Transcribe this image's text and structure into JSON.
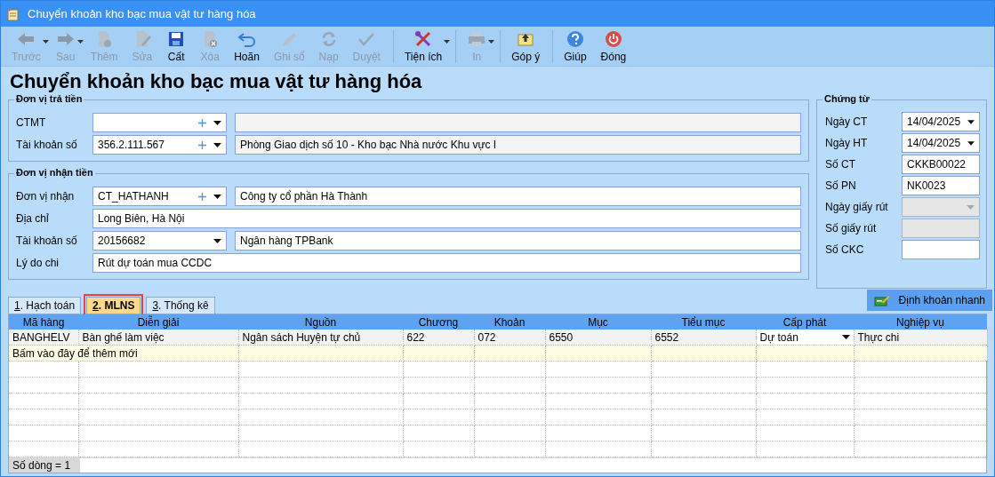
{
  "window": {
    "title": "Chuyển khoản kho bạc mua vật tư hàng hóa"
  },
  "toolbar": [
    {
      "kind": "back",
      "label": "Trước",
      "disabled": true,
      "menu": true,
      "separator_before": false
    },
    {
      "kind": "forward",
      "label": "Sau",
      "disabled": true,
      "menu": true,
      "separator_before": false
    },
    {
      "kind": "new",
      "label": "Thêm",
      "disabled": true,
      "menu": false,
      "separator_before": false
    },
    {
      "kind": "edit",
      "label": "Sửa",
      "disabled": true,
      "menu": false,
      "separator_before": false
    },
    {
      "kind": "save",
      "label": "Cất",
      "disabled": false,
      "menu": false,
      "separator_before": false
    },
    {
      "kind": "delete",
      "label": "Xóa",
      "disabled": true,
      "menu": false,
      "separator_before": false
    },
    {
      "kind": "undo",
      "label": "Hoãn",
      "disabled": false,
      "menu": false,
      "separator_before": false
    },
    {
      "kind": "post",
      "label": "Ghi sổ",
      "disabled": true,
      "menu": false,
      "separator_before": false
    },
    {
      "kind": "reload",
      "label": "Nạp",
      "disabled": true,
      "menu": false,
      "separator_before": false
    },
    {
      "kind": "approve",
      "label": "Duyệt",
      "disabled": true,
      "menu": false,
      "separator_before": false
    },
    {
      "kind": "tools",
      "label": "Tiện ích",
      "disabled": false,
      "menu": true,
      "separator_before": true
    },
    {
      "kind": "print",
      "label": "In",
      "disabled": true,
      "menu": true,
      "separator_before": true
    },
    {
      "kind": "feedback",
      "label": "Góp ý",
      "disabled": false,
      "menu": false,
      "separator_before": true
    },
    {
      "kind": "help",
      "label": "Giúp",
      "disabled": false,
      "menu": false,
      "separator_before": true
    },
    {
      "kind": "close",
      "label": "Đóng",
      "disabled": false,
      "menu": false,
      "separator_before": false
    }
  ],
  "heading": "Chuyển khoản kho bạc mua vật tư hàng hóa",
  "payer": {
    "title": "Đơn vị trả tiền",
    "rows": [
      {
        "label": "CTMT",
        "kind": "lookup",
        "description_disabled": true
      },
      {
        "label": "Tài khoản số",
        "kind": "lookup",
        "value": "356.2.111.567",
        "description": "Phòng Giao dịch số 10 - Kho bạc Nhà nước Khu vực I",
        "description_disabled": true
      }
    ]
  },
  "payee": {
    "title": "Đơn vị nhận tiền",
    "rows": [
      {
        "label": "Đơn vị nhận",
        "kind": "lookup",
        "value": "CT_HATHANH",
        "description": "Công ty cổ phần Hà Thành",
        "description_disabled": false
      },
      {
        "label": "Địa chỉ",
        "kind": "text",
        "value": "Long Biên, Hà Nội"
      },
      {
        "label": "Tài khoản số",
        "kind": "combo",
        "value": "20156682",
        "description": "Ngân hàng TPBank",
        "description_disabled": false
      },
      {
        "label": "Lý do chi",
        "kind": "text",
        "value": "Rút dự toán mua CCDC"
      }
    ]
  },
  "voucher": {
    "title": "Chứng từ",
    "rows": [
      {
        "label": "Ngày CT",
        "kind": "combo",
        "value": "14/04/2025",
        "disabled": false
      },
      {
        "label": "Ngày HT",
        "kind": "combo",
        "value": "14/04/2025",
        "disabled": false
      },
      {
        "label": "Số CT",
        "kind": "text",
        "value": "CKKB00022",
        "disabled": false
      },
      {
        "label": "Số PN",
        "kind": "text",
        "value": "NK0023",
        "disabled": false
      },
      {
        "label": "Ngày giấy rút",
        "kind": "combo",
        "disabled": true
      },
      {
        "label": "Số giấy rút",
        "kind": "text",
        "disabled": true
      },
      {
        "label": "Số CKC",
        "kind": "text",
        "disabled": false
      }
    ]
  },
  "tabs": [
    {
      "label": "1. Hạch toán",
      "selected": false
    },
    {
      "label": "2. MLNS",
      "selected": true
    },
    {
      "label": "3. Thống kê",
      "selected": false
    }
  ],
  "quick_entry_button": "Định khoản nhanh",
  "table": {
    "columns": [
      "Mã hàng",
      "Diễn giải",
      "Nguồn",
      "Chương",
      "Khoản",
      "Mục",
      "Tiểu mục",
      "Cấp phát",
      "Nghiệp vụ"
    ],
    "rows": [
      {
        "cells": [
          {
            "text": "BANGHELV",
            "kind": "text"
          },
          {
            "text": "Bàn ghế làm việc",
            "kind": "text"
          },
          {
            "text": "Ngân sách Huyện tự chủ",
            "kind": "text"
          },
          {
            "text": "622",
            "kind": "text"
          },
          {
            "text": "072",
            "kind": "text"
          },
          {
            "text": "6550",
            "kind": "text"
          },
          {
            "text": "6552",
            "kind": "text"
          },
          {
            "text": "Dự toán",
            "kind": "dropdown"
          },
          {
            "text": "Thực chi",
            "kind": "text"
          }
        ]
      }
    ],
    "new_row_hint": "Bấm vào đây để thêm mới",
    "footer": "Số dòng = 1"
  }
}
